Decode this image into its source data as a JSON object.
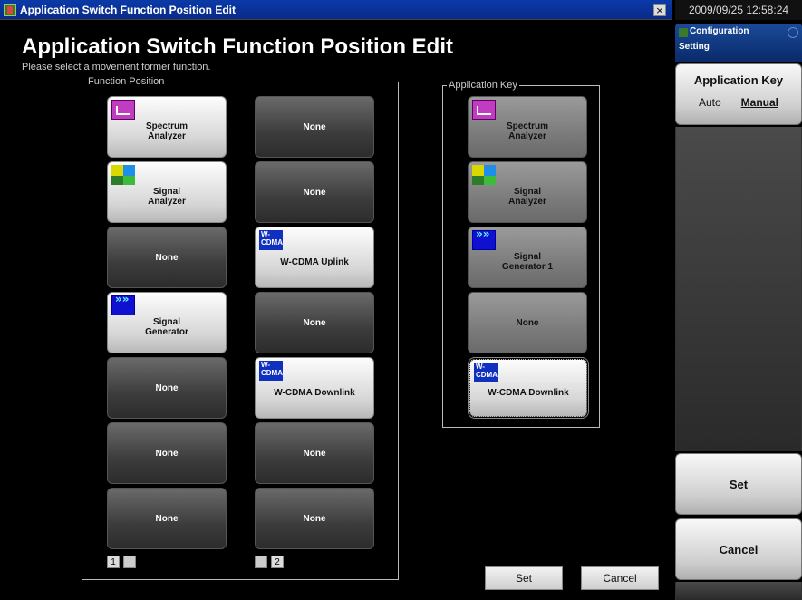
{
  "window": {
    "title": "Application Switch Function Position Edit",
    "close_glyph": "×"
  },
  "heading": "Application Switch Function Position Edit",
  "subheading": "Please select a movement former function.",
  "function_position": {
    "legend": "Function Position",
    "column1": [
      {
        "label": "Spectrum\nAnalyzer",
        "icon": "spectrum-analyzer-icon",
        "state": "filled"
      },
      {
        "label": "Signal\nAnalyzer",
        "icon": "signal-analyzer-icon",
        "state": "filled"
      },
      {
        "label": "None",
        "icon": "",
        "state": "none"
      },
      {
        "label": "Signal\nGenerator",
        "icon": "signal-generator-icon",
        "state": "filled"
      },
      {
        "label": "None",
        "icon": "",
        "state": "none"
      },
      {
        "label": "None",
        "icon": "",
        "state": "none"
      },
      {
        "label": "None",
        "icon": "",
        "state": "none"
      }
    ],
    "column2": [
      {
        "label": "None",
        "icon": "",
        "state": "none"
      },
      {
        "label": "None",
        "icon": "",
        "state": "none"
      },
      {
        "label": "W-CDMA Uplink",
        "icon": "wcdma-uplink-icon",
        "state": "filled"
      },
      {
        "label": "None",
        "icon": "",
        "state": "none"
      },
      {
        "label": "W-CDMA Downlink",
        "icon": "wcdma-downlink-icon",
        "state": "filled"
      },
      {
        "label": "None",
        "icon": "",
        "state": "none"
      },
      {
        "label": "None",
        "icon": "",
        "state": "none"
      }
    ],
    "page1": "1",
    "page2": "2"
  },
  "application_key": {
    "legend": "Application Key",
    "items": [
      {
        "label": "Spectrum\nAnalyzer",
        "icon": "spectrum-analyzer-icon",
        "state": "gray"
      },
      {
        "label": "Signal\nAnalyzer",
        "icon": "signal-analyzer-icon",
        "state": "gray"
      },
      {
        "label": "Signal\nGenerator 1",
        "icon": "signal-generator-icon",
        "state": "gray"
      },
      {
        "label": "None",
        "icon": "",
        "state": "gray"
      },
      {
        "label": "W-CDMA Downlink",
        "icon": "wcdma-downlink-icon",
        "state": "selected"
      }
    ]
  },
  "dialog_buttons": {
    "set": "Set",
    "cancel": "Cancel"
  },
  "right_panel": {
    "clock": "2009/09/25 12:58:24",
    "header_title": "Configuration",
    "header_sub": "Setting",
    "app_key_label": "Application Key",
    "opt_auto": "Auto",
    "opt_manual": "Manual",
    "selected_option": "Manual",
    "set_label": "Set",
    "cancel_label": "Cancel"
  },
  "icon_text": {
    "wcdma_up_1": "W-",
    "wcdma_up_2": "CDMA",
    "wcdma_down_1": "W-",
    "wcdma_down_2": "CDMA"
  }
}
